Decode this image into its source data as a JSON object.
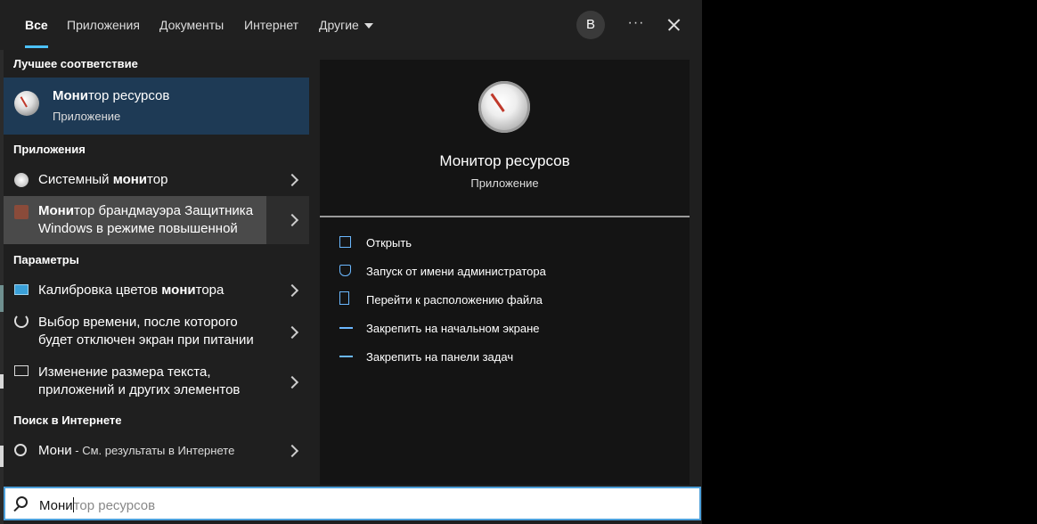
{
  "nav": {
    "tabs": [
      "Все",
      "Приложения",
      "Документы",
      "Интернет"
    ],
    "more_tab": "Другие",
    "avatar": "В",
    "more_icon": "···"
  },
  "sections": {
    "best": "Лучшее соответствие",
    "apps": "Приложения",
    "settings": "Параметры",
    "web": "Поиск в Интернете"
  },
  "best_match": {
    "bold": "Мони",
    "rest": "тор ресурсов",
    "sub": "Приложение"
  },
  "apps": [
    {
      "pre": "Системный ",
      "bold": "мони",
      "post": "тор"
    },
    {
      "bold": "Мони",
      "post": "тор брандмауэра Защитника",
      "line2": "Windows в режиме повышенной"
    }
  ],
  "settings": [
    {
      "pre": "Калибровка цветов ",
      "bold": "мони",
      "post": "тора"
    },
    {
      "line1": "Выбор времени, после которого",
      "line2": "будет отключен экран при питании"
    },
    {
      "line1": "Изменение размера текста,",
      "line2": "приложений и других элементов"
    }
  ],
  "web": {
    "term": "Мони",
    "hint": " - См. результаты в Интернете"
  },
  "preview": {
    "title": "Монитор ресурсов",
    "sub": "Приложение",
    "actions": [
      "Открыть",
      "Запуск от имени администратора",
      "Перейти к расположению файла",
      "Закрепить на начальном экране",
      "Закрепить на панели задач"
    ]
  },
  "search": {
    "typed": "Мони",
    "ghost": "тор ресурсов"
  }
}
